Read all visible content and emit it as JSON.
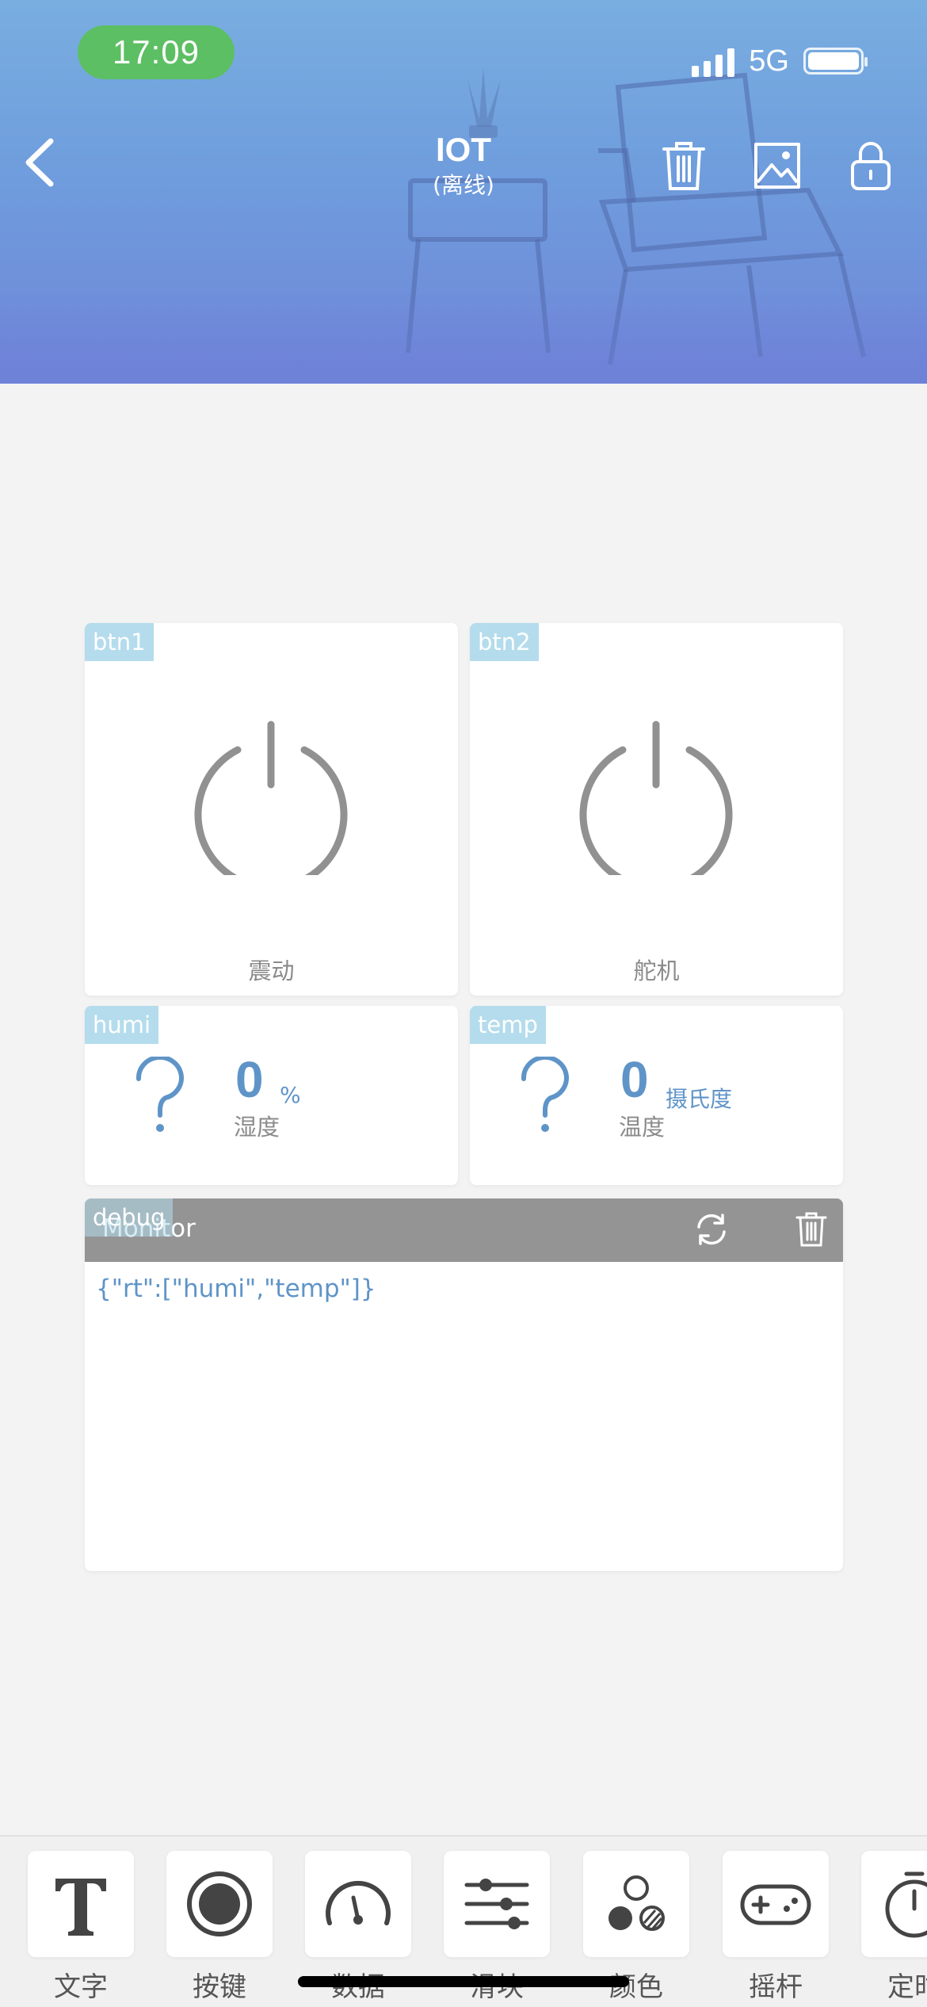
{
  "status_bar": {
    "time": "17:09",
    "network": "5G"
  },
  "header": {
    "title": "IOT",
    "subtitle": "(离线)"
  },
  "widgets": {
    "btn1": {
      "tag": "btn1",
      "label": "震动"
    },
    "btn2": {
      "tag": "btn2",
      "label": "舵机"
    },
    "humi": {
      "tag": "humi",
      "value": "0",
      "unit": "%",
      "name": "湿度"
    },
    "temp": {
      "tag": "temp",
      "value": "0",
      "unit": "摄氏度",
      "name": "温度"
    },
    "debug": {
      "tag": "debug",
      "title": "Monitor",
      "log": "{\"rt\":[\"humi\",\"temp\"]}"
    }
  },
  "toolbar": {
    "items": [
      {
        "label": "文字",
        "icon": "text-icon"
      },
      {
        "label": "按键",
        "icon": "button-icon"
      },
      {
        "label": "数据",
        "icon": "gauge-icon"
      },
      {
        "label": "滑块",
        "icon": "slider-icon"
      },
      {
        "label": "颜色",
        "icon": "color-icon"
      },
      {
        "label": "摇杆",
        "icon": "gamepad-icon"
      },
      {
        "label": "定时",
        "icon": "timer-icon"
      }
    ]
  },
  "colors": {
    "status_time_bg": "#5dbf64",
    "accent_value": "#5f94c8",
    "tag_bg": "#b4dcec",
    "debug_bar": "#949494"
  }
}
